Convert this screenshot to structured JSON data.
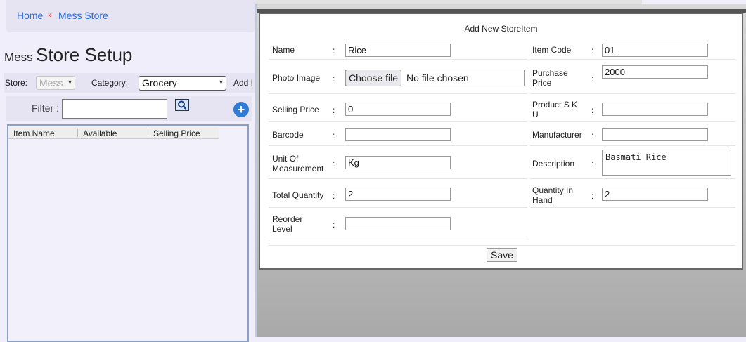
{
  "breadcrumb": {
    "home": "Home",
    "separator": "»",
    "current": "Mess Store"
  },
  "page_title": {
    "prefix": "Mess",
    "main": "Store Setup"
  },
  "toolbar": {
    "store_label": "Store:",
    "store_value": "Mess",
    "category_label": "Category:",
    "category_value": "Grocery",
    "add_label": "Add I"
  },
  "filter": {
    "label": "Filter :",
    "value": ""
  },
  "list": {
    "columns": [
      "Item Name",
      "Available",
      "Selling Price"
    ]
  },
  "dialog": {
    "title": "Add New StoreItem",
    "colon": ":",
    "name_label": "Name",
    "name_value": "Rice",
    "item_code_label": "Item Code",
    "item_code_value": "01",
    "photo_label": "Photo Image",
    "choose_file": "Choose file",
    "no_file": "No file chosen",
    "purchase_label": "Purchase Price",
    "purchase_value": "2000",
    "selling_label": "Selling Price",
    "selling_value": "0",
    "sku_label": "Product S K U",
    "sku_value": "",
    "barcode_label": "Barcode",
    "barcode_value": "",
    "manufacturer_label": "Manufacturer",
    "manufacturer_value": "",
    "uom_label": "Unit Of Measurement",
    "uom_value": "Kg",
    "description_label": "Description",
    "description_value": "Basmati Rice",
    "total_qty_label": "Total Quantity",
    "total_qty_value": "2",
    "qty_hand_label": "Quantity In Hand",
    "qty_hand_value": "2",
    "reorder_label": "Reorder Level",
    "reorder_value": "",
    "save": "Save"
  }
}
